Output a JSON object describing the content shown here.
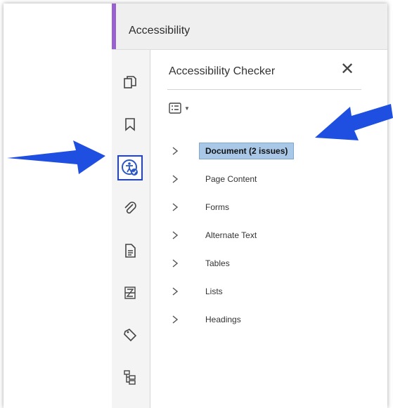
{
  "header": {
    "title": "Accessibility"
  },
  "panel": {
    "title": "Accessibility Checker",
    "close_label": "✕",
    "items": [
      {
        "label": "Document (2 issues)",
        "selected": true
      },
      {
        "label": "Page Content",
        "selected": false
      },
      {
        "label": "Forms",
        "selected": false
      },
      {
        "label": "Alternate Text",
        "selected": false
      },
      {
        "label": "Tables",
        "selected": false
      },
      {
        "label": "Lists",
        "selected": false
      },
      {
        "label": "Headings",
        "selected": false
      }
    ]
  },
  "rail": {
    "icons": [
      "pages-icon",
      "bookmark-icon",
      "accessibility-check-icon",
      "attachment-icon",
      "document-icon",
      "content-icon",
      "tag-icon",
      "order-tree-icon"
    ],
    "active": "accessibility-check-icon"
  },
  "colors": {
    "accent": "#9a5fd0",
    "highlight": "#1a3ff0",
    "selection": "#a9c8e8",
    "arrow": "#1f4fe0"
  }
}
